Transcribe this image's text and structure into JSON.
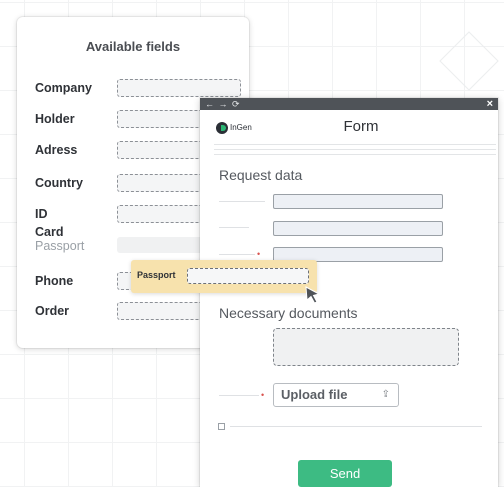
{
  "available_fields": {
    "title": "Available fields",
    "items": [
      {
        "label": "Company",
        "state": "available"
      },
      {
        "label": "Holder",
        "state": "available"
      },
      {
        "label": "Adress",
        "state": "available"
      },
      {
        "label": "Country",
        "state": "available"
      },
      {
        "label": "ID Card",
        "state": "available"
      },
      {
        "label": "Passport",
        "state": "dragging"
      },
      {
        "label": "Phone",
        "state": "available"
      },
      {
        "label": "Order",
        "state": "available"
      }
    ]
  },
  "form_window": {
    "nav_icons": "← → ⟳",
    "close": "×",
    "logo_text": "InGen",
    "title": "Form",
    "request_section": "Request data",
    "documents_section": "Necessary documents",
    "upload_label": "Upload file",
    "upload_icon": "upload-icon",
    "send_label": "Send"
  },
  "drag_chip": {
    "label": "Passport"
  },
  "colors": {
    "accent": "#3dbb83",
    "titlebar": "#4f5358",
    "drag_highlight": "#f7e2ad",
    "required": "#d9534f"
  }
}
